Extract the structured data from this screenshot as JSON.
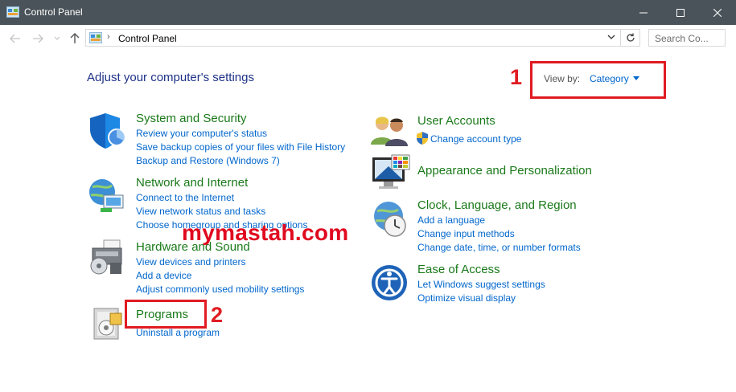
{
  "window": {
    "title": "Control Panel"
  },
  "address": {
    "crumb": "Control Panel",
    "search_placeholder": "Search Co..."
  },
  "header": {
    "heading": "Adjust your computer's settings",
    "view_by_label": "View by:",
    "view_by_value": "Category"
  },
  "annotations": {
    "num1": "1",
    "num2": "2",
    "watermark": "mymastah.com"
  },
  "categories": {
    "system": {
      "title": "System and Security",
      "links": [
        "Review your computer's status",
        "Save backup copies of your files with File History",
        "Backup and Restore (Windows 7)"
      ]
    },
    "network": {
      "title": "Network and Internet",
      "links": [
        "Connect to the Internet",
        "View network status and tasks",
        "Choose homegroup and sharing options"
      ]
    },
    "hardware": {
      "title": "Hardware and Sound",
      "links": [
        "View devices and printers",
        "Add a device",
        "Adjust commonly used mobility settings"
      ]
    },
    "programs": {
      "title": "Programs",
      "links": [
        "Uninstall a program"
      ]
    },
    "users": {
      "title": "User Accounts",
      "links": [
        "Change account type"
      ]
    },
    "appearance": {
      "title": "Appearance and Personalization",
      "links": []
    },
    "clock": {
      "title": "Clock, Language, and Region",
      "links": [
        "Add a language",
        "Change input methods",
        "Change date, time, or number formats"
      ]
    },
    "ease": {
      "title": "Ease of Access",
      "links": [
        "Let Windows suggest settings",
        "Optimize visual display"
      ]
    }
  },
  "colors": {
    "titlebar": "#4a5359",
    "link": "#0066cc",
    "category_title": "#1a7a1a",
    "heading": "#1e3287",
    "annotation_red": "#e01b22"
  }
}
